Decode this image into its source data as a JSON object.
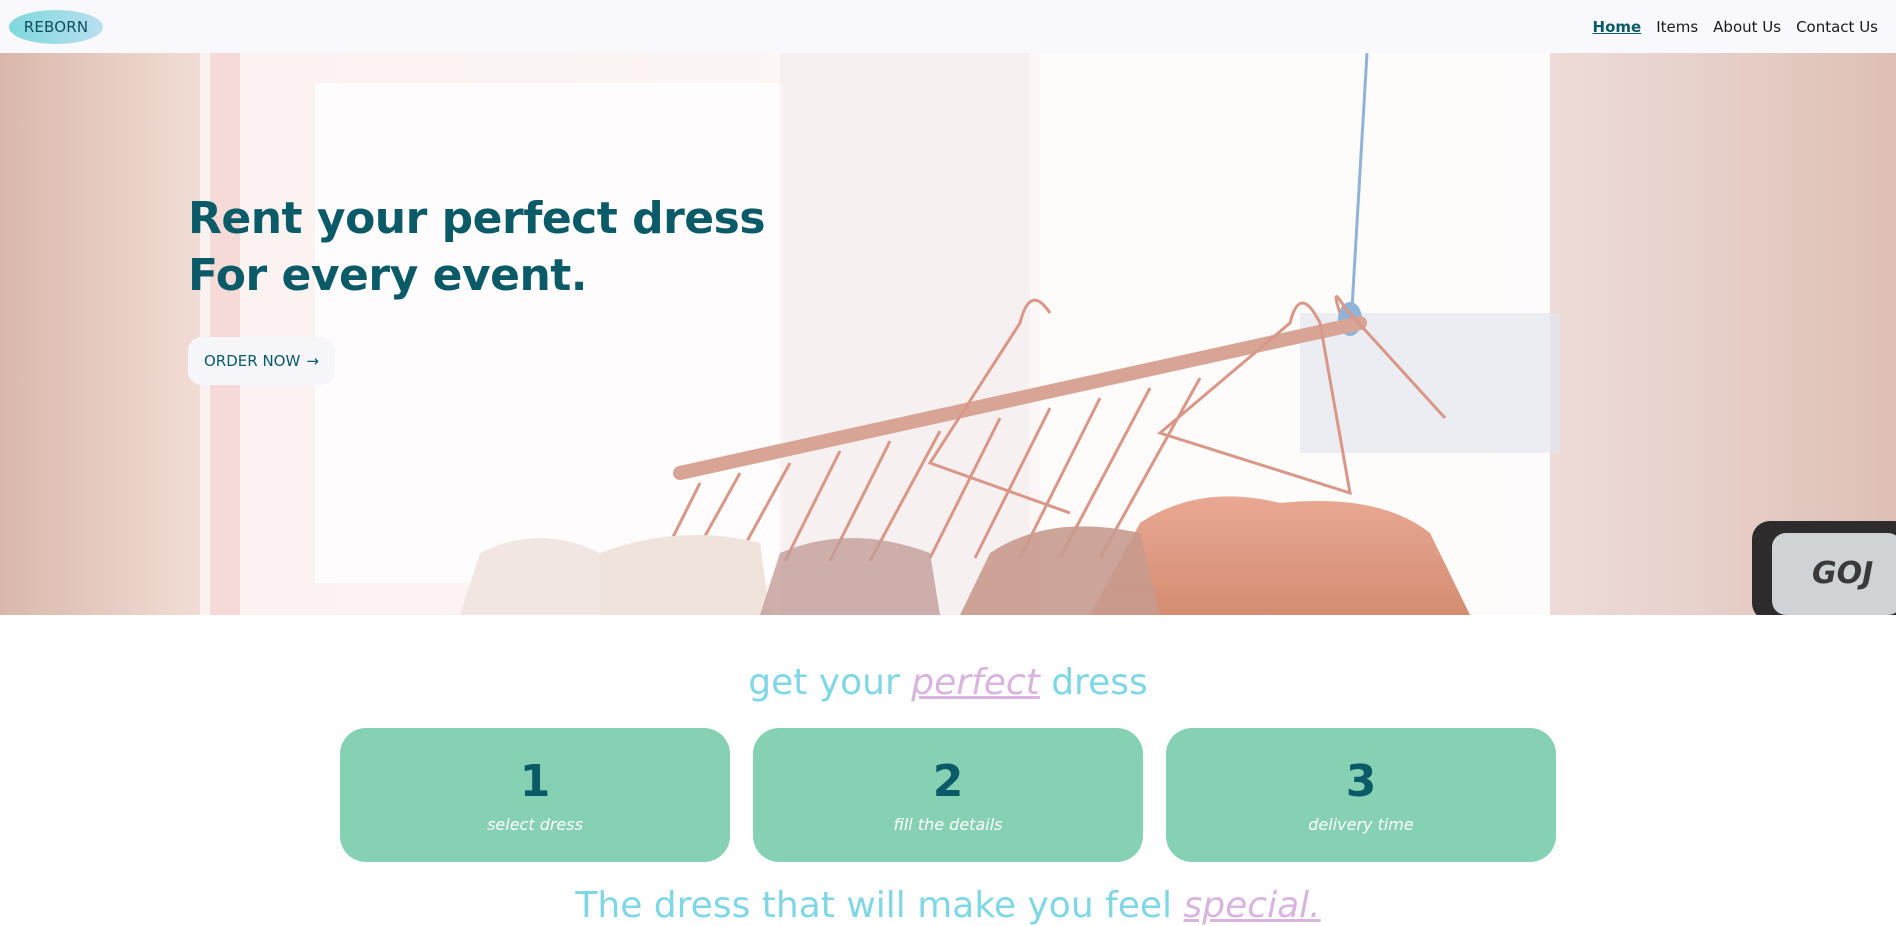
{
  "navbar": {
    "logo": "REBORN",
    "links": [
      {
        "label": "Home",
        "active": true
      },
      {
        "label": "Items"
      },
      {
        "label": "About Us"
      },
      {
        "label": "Contact Us"
      }
    ]
  },
  "hero": {
    "title_line1": "Rent your perfect dress",
    "title_line2": "For every event.",
    "cta_label": "ORDER NOW",
    "cta_icon": "arrow-right-icon",
    "cta_arrow": "→",
    "image_description_icon": "clothes-rack-image",
    "dispenser_text": "GOJ"
  },
  "steps": {
    "heading_pre": "get your",
    "heading_accent": "perfect",
    "heading_post": "dress",
    "items": [
      {
        "number": "1",
        "label": "select dress"
      },
      {
        "number": "2",
        "label": "fill the details"
      },
      {
        "number": "3",
        "label": "delivery time"
      }
    ]
  },
  "tagline": {
    "pre": "The dress that will make you feel",
    "accent": "special."
  },
  "colors": {
    "primary": "#0b5a68",
    "accent_cyan": "#7fd7e5",
    "accent_pink": "#d8b4de",
    "card_green": "#86d1b3",
    "nav_bg": "#f8f8fd"
  }
}
